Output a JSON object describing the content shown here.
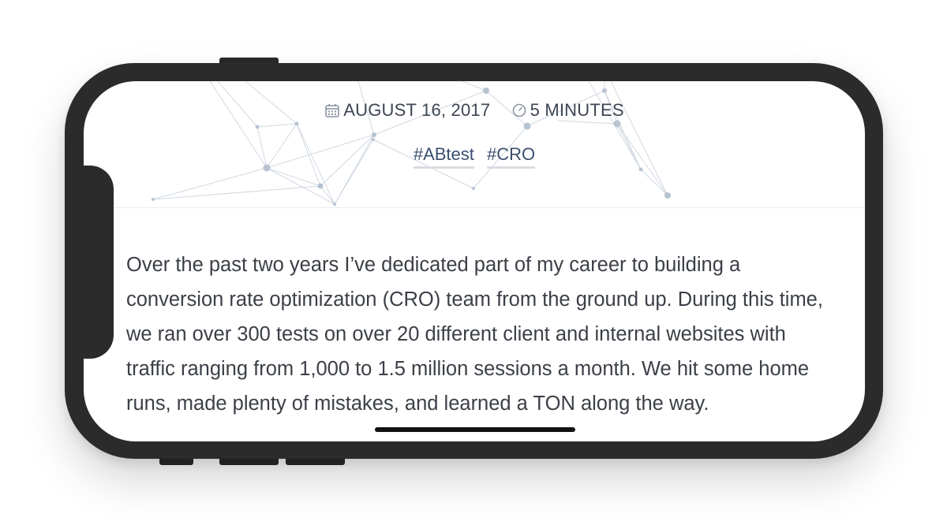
{
  "post": {
    "date": "AUGUST 16, 2017",
    "read_time": "5 MINUTES",
    "tags": [
      "#ABtest",
      "#CRO"
    ],
    "body": "Over the past two years I’ve dedicated part of my career to building a conversion rate optimization (CRO) team from the ground up. During this time, we ran over 300 tests on over 20 different client and internal websites with traffic ranging from 1,000 to 1.5 million sessions a month. We hit some home runs, made plenty of mistakes, and learned a TON along the way."
  },
  "icons": {
    "date": "calendar-icon",
    "read_time": "clock-icon"
  },
  "colors": {
    "tag_text": "#3b4f6e",
    "network_nodes": "#b8c3d1",
    "device_frame": "#2b2b2b"
  }
}
